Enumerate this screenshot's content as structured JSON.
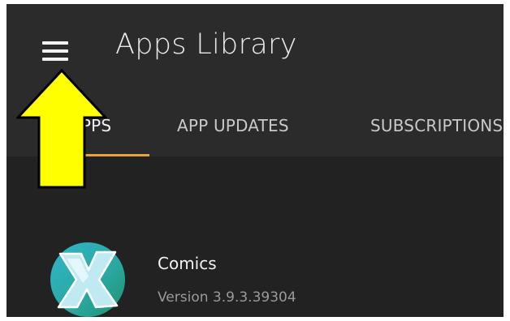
{
  "header": {
    "title": "Apps Library",
    "menu_icon": "hamburger-menu-icon"
  },
  "tabs": [
    {
      "label": "APPS",
      "selected": true
    },
    {
      "label": "APP UPDATES",
      "selected": false
    },
    {
      "label": "SUBSCRIPTIONS",
      "selected": false
    }
  ],
  "apps": [
    {
      "name": "Comics",
      "version": "Version 3.9.3.39304",
      "icon": "comixology-x-logo-icon"
    }
  ],
  "annotation": {
    "icon": "yellow-up-arrow-icon",
    "color": "#ffff00"
  },
  "colors": {
    "background": "#222222",
    "header_background": "#2b2b2b",
    "tab_indicator": "#e8a33a",
    "text_primary": "#f2f2f2",
    "text_secondary": "#9a9a9a"
  }
}
